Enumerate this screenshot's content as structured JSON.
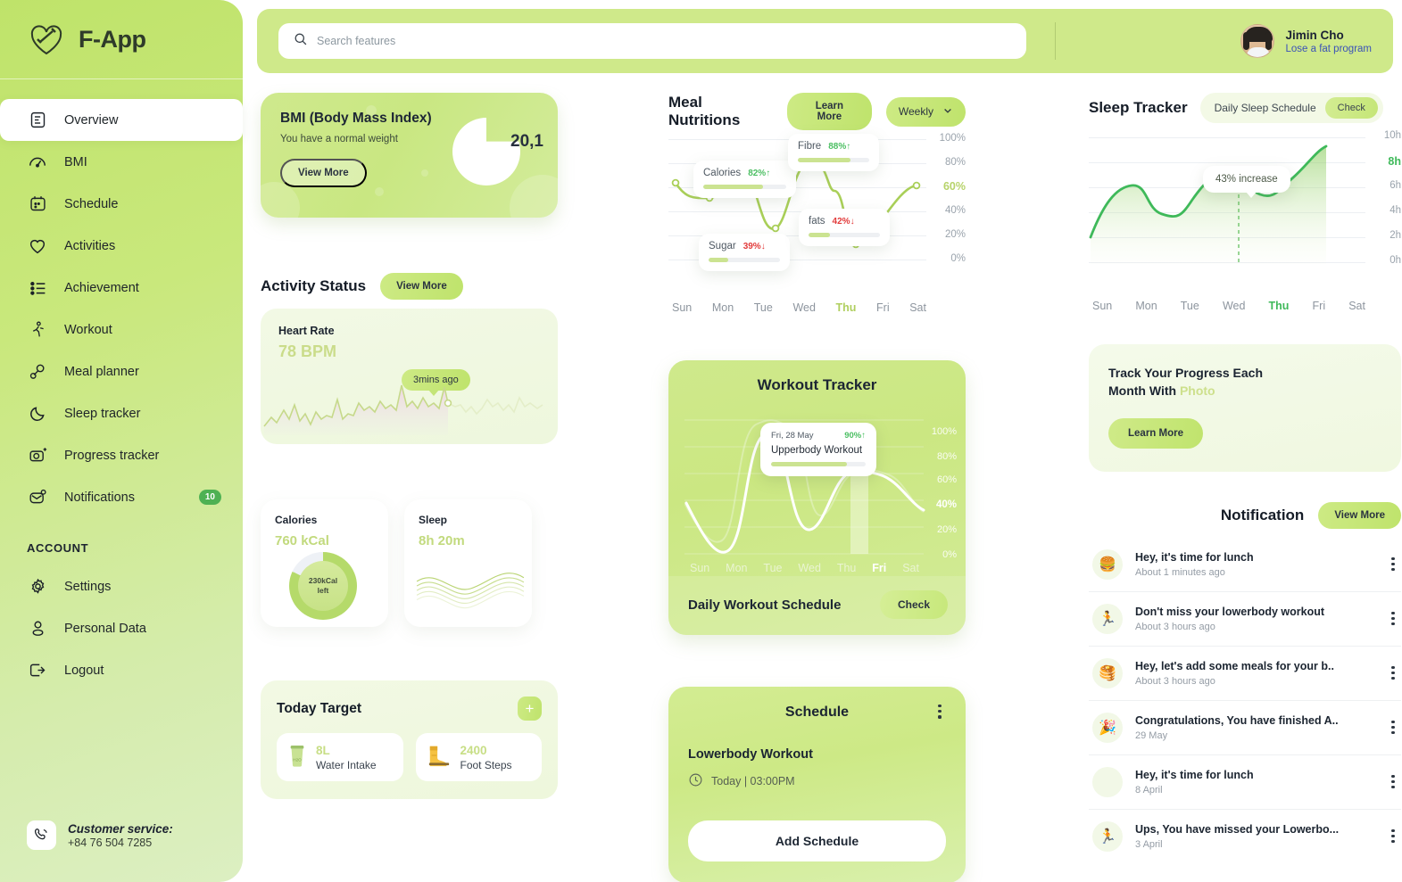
{
  "brand": {
    "name": "F-App",
    "logo_icon": "heart-dumbbell-icon"
  },
  "sidebar": {
    "items": [
      {
        "label": "Overview",
        "icon": "document-overview-icon",
        "active": true
      },
      {
        "label": "BMI",
        "icon": "gauge-icon",
        "active": false
      },
      {
        "label": "Schedule",
        "icon": "calendar-icon",
        "active": false
      },
      {
        "label": "Activities",
        "icon": "heart-icon",
        "active": false
      },
      {
        "label": "Achievement",
        "icon": "list-icon",
        "active": false
      },
      {
        "label": "Workout",
        "icon": "running-person-icon",
        "active": false
      },
      {
        "label": "Meal planner",
        "icon": "drumstick-icon",
        "active": false
      },
      {
        "label": "Sleep tracker",
        "icon": "moon-icon",
        "active": false
      },
      {
        "label": "Progress tracker",
        "icon": "camera-plus-icon",
        "active": false
      },
      {
        "label": "Notifications",
        "icon": "bell-message-icon",
        "active": false,
        "badge": "10"
      }
    ],
    "account_section": "ACCOUNT",
    "account_items": [
      {
        "label": "Settings",
        "icon": "gear-icon"
      },
      {
        "label": "Personal Data",
        "icon": "user-icon"
      },
      {
        "label": "Logout",
        "icon": "logout-icon"
      }
    ],
    "support": {
      "icon": "phone-icon",
      "title": "Customer service:",
      "phone": "+84 76 504 7285"
    }
  },
  "topbar": {
    "search_placeholder": "Search features",
    "search_value": "",
    "search_icon": "search-icon",
    "profile": {
      "name": "Jimin Cho",
      "program": "Lose a fat program"
    }
  },
  "bmi": {
    "title": "BMI (Body Mass Index)",
    "subtitle": "You have a normal weight",
    "button": "View More",
    "value": "20,1"
  },
  "activity": {
    "title": "Activity Status",
    "button": "View More",
    "heart_label": "Heart Rate",
    "heart_value": "78 BPM",
    "heart_badge": "3mins ago"
  },
  "stats": [
    {
      "label": "Calories",
      "value": "760 kCal",
      "ring_text_1": "230kCal",
      "ring_text_2": "left"
    },
    {
      "label": "Sleep",
      "value": "8h 20m"
    }
  ],
  "today_target": {
    "title": "Today Target",
    "add_button": "+",
    "items": [
      {
        "icon": "water-glass-icon",
        "value": "8L",
        "name": "Water Intake"
      },
      {
        "icon": "boots-icon",
        "value": "2400",
        "name": "Foot Steps"
      }
    ]
  },
  "meal": {
    "title": "Meal Nutritions",
    "learn_more": "Learn More",
    "period": "Weekly",
    "chevron_icon": "chevron-down-icon",
    "tooltips": [
      {
        "name": "Calories",
        "pct": "82%",
        "dir": "up",
        "arrow": "↑",
        "fill": 72
      },
      {
        "name": "Fibre",
        "pct": "88%",
        "dir": "up",
        "arrow": "↑",
        "fill": 74
      },
      {
        "name": "Sugar",
        "pct": "39%",
        "dir": "down",
        "arrow": "↓",
        "fill": 28
      },
      {
        "name": "fats",
        "pct": "42%",
        "dir": "down",
        "arrow": "↓",
        "fill": 30
      }
    ]
  },
  "workout": {
    "title": "Workout Tracker",
    "tip_date": "Fri, 28 May",
    "tip_pct": "90%",
    "tip_arrow": "↑",
    "tip_name": "Upperbody Workout",
    "tip_fill": 80,
    "footer_title": "Daily Workout Schedule",
    "footer_button": "Check"
  },
  "schedule": {
    "title": "Schedule",
    "menu_icon": "kebab-menu-icon",
    "item_name": "Lowerbody Workout",
    "item_time": "Today | 03:00PM",
    "clock_icon": "clock-icon",
    "add_button": "Add Schedule"
  },
  "sleep": {
    "title": "Sleep Tracker",
    "pill_label": "Daily Sleep Schedule",
    "check_button": "Check",
    "tooltip": "43% increase"
  },
  "promo": {
    "line1": "Track Your Progress Each",
    "line2_prefix": "Month With ",
    "line2_accent": "Photo",
    "button": "Learn More"
  },
  "notification": {
    "title": "Notification",
    "view_more": "View More",
    "items": [
      {
        "icon": "🍔",
        "text": "Hey, it's time for lunch",
        "time": "About 1 minutes ago"
      },
      {
        "icon": "🏃",
        "text": "Don't miss your lowerbody workout",
        "time": "About 3 hours ago"
      },
      {
        "icon": "🥞",
        "text": "Hey, let's add some meals for your b..",
        "time": "About 3 hours ago"
      },
      {
        "icon": "🎉",
        "text": "Congratulations, You have finished A..",
        "time": "29 May"
      },
      {
        "icon": "",
        "text": "Hey, it's time for lunch",
        "time": "8 April"
      },
      {
        "icon": "🏃",
        "text": "Ups, You have missed your Lowerbo...",
        "time": "3 April"
      }
    ]
  },
  "chart_data": [
    {
      "type": "line",
      "title": "Meal Nutritions",
      "categories": [
        "Sun",
        "Mon",
        "Tue",
        "Wed",
        "Thu",
        "Fri",
        "Sat"
      ],
      "values": [
        62,
        50,
        66,
        37,
        80,
        22,
        60
      ],
      "ytick_labels": [
        "100%",
        "80%",
        "60%",
        "40%",
        "20%",
        "0%"
      ],
      "ylim": [
        0,
        100
      ],
      "ylabel": "",
      "xlabel": "",
      "highlight_x": "Thu",
      "highlight_y_label": "60%",
      "grid": true,
      "legend": "none",
      "line_color": "#a9cf58"
    },
    {
      "type": "area",
      "title": "Sleep Tracker",
      "categories": [
        "Sun",
        "Mon",
        "Tue",
        "Wed",
        "Thu",
        "Fri",
        "Sat"
      ],
      "values": [
        2.0,
        5.0,
        3.6,
        6.2,
        5.3,
        4.5,
        8.0
      ],
      "ytick_labels": [
        "10h",
        "8h",
        "6h",
        "4h",
        "2h",
        "0h"
      ],
      "ylim": [
        0,
        10
      ],
      "ylabel": "hours",
      "xlabel": "",
      "highlight_x": "Thu",
      "highlight_y_label": "8h",
      "annotation": "43% increase",
      "grid": true,
      "legend": "none",
      "line_color": "#3fb95a"
    },
    {
      "type": "line",
      "title": "Workout Tracker",
      "categories": [
        "Sun",
        "Mon",
        "Tue",
        "Wed",
        "Thu",
        "Fri",
        "Sat"
      ],
      "values": [
        42,
        10,
        95,
        22,
        70,
        70,
        40
      ],
      "ytick_labels": [
        "100%",
        "80%",
        "60%",
        "40%",
        "20%",
        "0%"
      ],
      "ylim": [
        0,
        100
      ],
      "ylabel": "",
      "xlabel": "",
      "highlight_x": "Fri",
      "highlight_y_label": "40%",
      "grid": true,
      "legend": "none",
      "line_color": "#ffffff"
    },
    {
      "type": "line",
      "title": "Heart Rate",
      "categories": [],
      "values": [],
      "annotation": "3mins ago",
      "value_label": "78 BPM",
      "line_color": "#cadc8a"
    }
  ]
}
